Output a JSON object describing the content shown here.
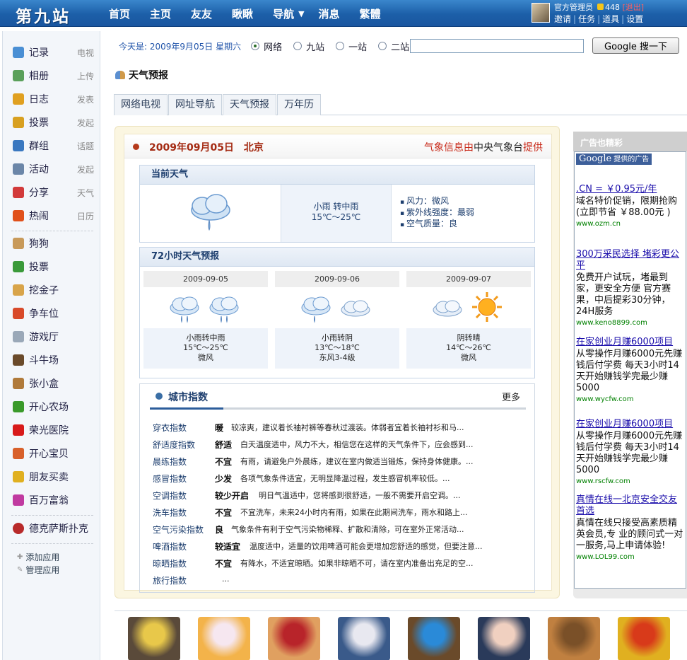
{
  "brand": {
    "logo": "第九站"
  },
  "topnav": {
    "items": [
      "首页",
      "主页",
      "友友",
      "瞅瞅",
      "导航",
      "消息",
      "繁體"
    ],
    "dropdown_arrow": "▼"
  },
  "user": {
    "name": "官方管理员",
    "coins": "448",
    "logout": "[退出]",
    "links": [
      "邀请",
      "任务",
      "道具",
      "设置"
    ]
  },
  "sidebar": {
    "apps": [
      {
        "label": "记录",
        "sub": "电视",
        "icon": "chat-bubble-icon",
        "color": "#4a8fd4"
      },
      {
        "label": "相册",
        "sub": "上传",
        "icon": "photo-icon",
        "color": "#5aa05a"
      },
      {
        "label": "日志",
        "sub": "发表",
        "icon": "notebook-icon",
        "color": "#e0a020"
      },
      {
        "label": "投票",
        "sub": "发起",
        "icon": "bar-chart-icon",
        "color": "#d8a020"
      },
      {
        "label": "群组",
        "sub": "话题",
        "icon": "group-icon",
        "color": "#3a78c0"
      },
      {
        "label": "活动",
        "sub": "发起",
        "icon": "calendar-icon",
        "color": "#6b86a8"
      },
      {
        "label": "分享",
        "sub": "天气",
        "icon": "heart-icon",
        "color": "#d23a3a"
      },
      {
        "label": "热闹",
        "sub": "日历",
        "icon": "fire-icon",
        "color": "#e0501a"
      }
    ],
    "games": [
      {
        "label": "狗狗",
        "icon": "dog-icon",
        "color": "#c89a5a"
      },
      {
        "label": "投票",
        "icon": "bar-chart-icon",
        "color": "#3a9a3a"
      },
      {
        "label": "挖金子",
        "icon": "gold-icon",
        "color": "#d8a44a"
      },
      {
        "label": "争车位",
        "icon": "parking-icon",
        "color": "#d84a2a"
      },
      {
        "label": "游戏厅",
        "icon": "gamepad-icon",
        "color": "#9aa8b8"
      },
      {
        "label": "斗牛场",
        "icon": "bull-icon",
        "color": "#6a4a2a"
      },
      {
        "label": "张小盒",
        "icon": "box-icon",
        "color": "#b07a3a"
      },
      {
        "label": "开心农场",
        "icon": "sprout-icon",
        "color": "#3a9a2a"
      },
      {
        "label": "荣光医院",
        "icon": "red-cross-icon",
        "color": "#d81a1a"
      },
      {
        "label": "开心宝贝",
        "icon": "baby-icon",
        "color": "#d8602a"
      },
      {
        "label": "朋友买卖",
        "icon": "coins-icon",
        "color": "#e0b020"
      },
      {
        "label": "百万富翁",
        "icon": "star-icon",
        "color": "#c03aa0"
      }
    ],
    "poker": {
      "label": "德克萨斯扑克",
      "icon": "poker-chip-icon",
      "color": "#b82a2a"
    },
    "links": [
      "添加应用",
      "管理应用"
    ]
  },
  "search": {
    "date_text": "今天是: 2009年9月05日 星期六",
    "options": [
      "网络",
      "九站",
      "一站",
      "二站"
    ],
    "selected_index": 0,
    "input_value": "",
    "button": "Google 搜一下"
  },
  "page": {
    "title": "天气预报",
    "tabs": [
      "网络电视",
      "网址导航",
      "天气预报",
      "万年历"
    ]
  },
  "weather": {
    "date_city": "2009年09月05日　北京",
    "source_pre": "气象信息由",
    "source_org": "中央气象台",
    "source_post": "提供",
    "current": {
      "title": "当前天气",
      "condition": "小雨 转中雨",
      "temp": "15℃～25℃",
      "details": [
        "风力：微风",
        "紫外线强度：最弱",
        "空气质量：良"
      ]
    },
    "forecast": {
      "title": "72小时天气预报",
      "days": [
        {
          "date": "2009-09-05",
          "condition": "小雨转中雨",
          "temp": "15℃～25℃",
          "wind": "微风",
          "icons": [
            "rain-cloud-icon",
            "rain-cloud-icon"
          ]
        },
        {
          "date": "2009-09-06",
          "condition": "小雨转阴",
          "temp": "13℃～18℃",
          "wind": "东风3-4级",
          "icons": [
            "rain-cloud-icon",
            "cloud-icon"
          ]
        },
        {
          "date": "2009-09-07",
          "condition": "阴转晴",
          "temp": "14℃～26℃",
          "wind": "微风",
          "icons": [
            "cloud-icon",
            "sun-icon"
          ]
        }
      ]
    },
    "city_index": {
      "title": "城市指数",
      "more": "更多",
      "rows": [
        {
          "name": "穿衣指数",
          "level": "暖",
          "desc": "较凉爽，建议着长袖衬裤等春秋过渡装。体弱者宜着长袖衬衫和马..."
        },
        {
          "name": "舒适度指数",
          "level": "舒适",
          "desc": "白天温度适中，风力不大，相信您在这样的天气条件下，应会感到..."
        },
        {
          "name": "晨练指数",
          "level": "不宜",
          "desc": "有雨，请避免户外晨练，建议在室内做适当锻炼，保持身体健康。..."
        },
        {
          "name": "感冒指数",
          "level": "少发",
          "desc": "各项气象条件适宜，无明显降温过程，发生感冒机率较低。..."
        },
        {
          "name": "空调指数",
          "level": "较少开启",
          "desc": "明日气温适中，您将感到很舒适，一般不需要开启空调。..."
        },
        {
          "name": "洗车指数",
          "level": "不宜",
          "desc": "不宜洗车，未来24小时内有雨，如果在此期间洗车，雨水和路上..."
        },
        {
          "name": "空气污染指数",
          "level": "良",
          "desc": "气象条件有利于空气污染物稀释、扩散和清除，可在室外正常活动..."
        },
        {
          "name": "啤酒指数",
          "level": "较适宜",
          "desc": "温度适中，适量的饮用啤酒可能会更增加您舒适的感觉，但要注意..."
        },
        {
          "name": "晾晒指数",
          "level": "不宜",
          "desc": "有降水，不适宜晾晒。如果非晾晒不可，请在室内准备出充足的空..."
        },
        {
          "name": "旅行指数",
          "level": "",
          "desc": "..."
        }
      ]
    }
  },
  "ads": {
    "header": "广告也精彩",
    "google_label": "Google",
    "google_suffix": "提供的广告",
    "items": [
      {
        "title": ".CN = ￥0.95元/年",
        "body": "域名特价促销，限期抢购(立即节省 ￥88.00元 )",
        "url": "www.ozm.cn"
      },
      {
        "title": "300万采民选择 堵彩更公平",
        "body": "免费开户试玩，堵最到家，更安全方便 官方赛果，中后提彩30分钟，24H服务",
        "url": "www.keno8899.com"
      },
      {
        "title": "在家创业月赚6000项目",
        "body": "从零操作月赚6000元先赚钱后付学费 每天3小时14天开始赚钱学完最少赚5000",
        "url": "www.wycfw.com"
      },
      {
        "title": "在家创业月赚6000项目",
        "body": "从零操作月赚6000元先赚钱后付学费 每天3小时14天开始赚钱学完最少赚5000",
        "url": "www.rscfw.com"
      },
      {
        "title": "真情在线一北京安全交友首选",
        "body": "真情在线只接受高素质精英会员,专 业的顾问式一对一服务,马上申请体验!",
        "url": "www.LOL99.com"
      }
    ]
  },
  "bottom_games": [
    {
      "name": "husky-dog-game-icon",
      "colors": [
        "#5a4a3a",
        "#e8c84a"
      ]
    },
    {
      "name": "bunny-game-icon",
      "colors": [
        "#f3b34a",
        "#f6e7f0"
      ]
    },
    {
      "name": "old-man-game-icon",
      "colors": [
        "#e0a060",
        "#b8242a"
      ]
    },
    {
      "name": "poker-cards-game-icon",
      "colors": [
        "#3a5a8a",
        "#e8e8f0"
      ]
    },
    {
      "name": "five-game-icon",
      "colors": [
        "#6a4a2a",
        "#2a8ad8"
      ]
    },
    {
      "name": "nurse-game-icon",
      "colors": [
        "#2a3a5a",
        "#f0d0c0"
      ]
    },
    {
      "name": "box-character-game-icon",
      "colors": [
        "#c08040",
        "#7a5028"
      ]
    },
    {
      "name": "millionaire-game-icon",
      "colors": [
        "#e0b020",
        "#d83a1a"
      ]
    }
  ]
}
